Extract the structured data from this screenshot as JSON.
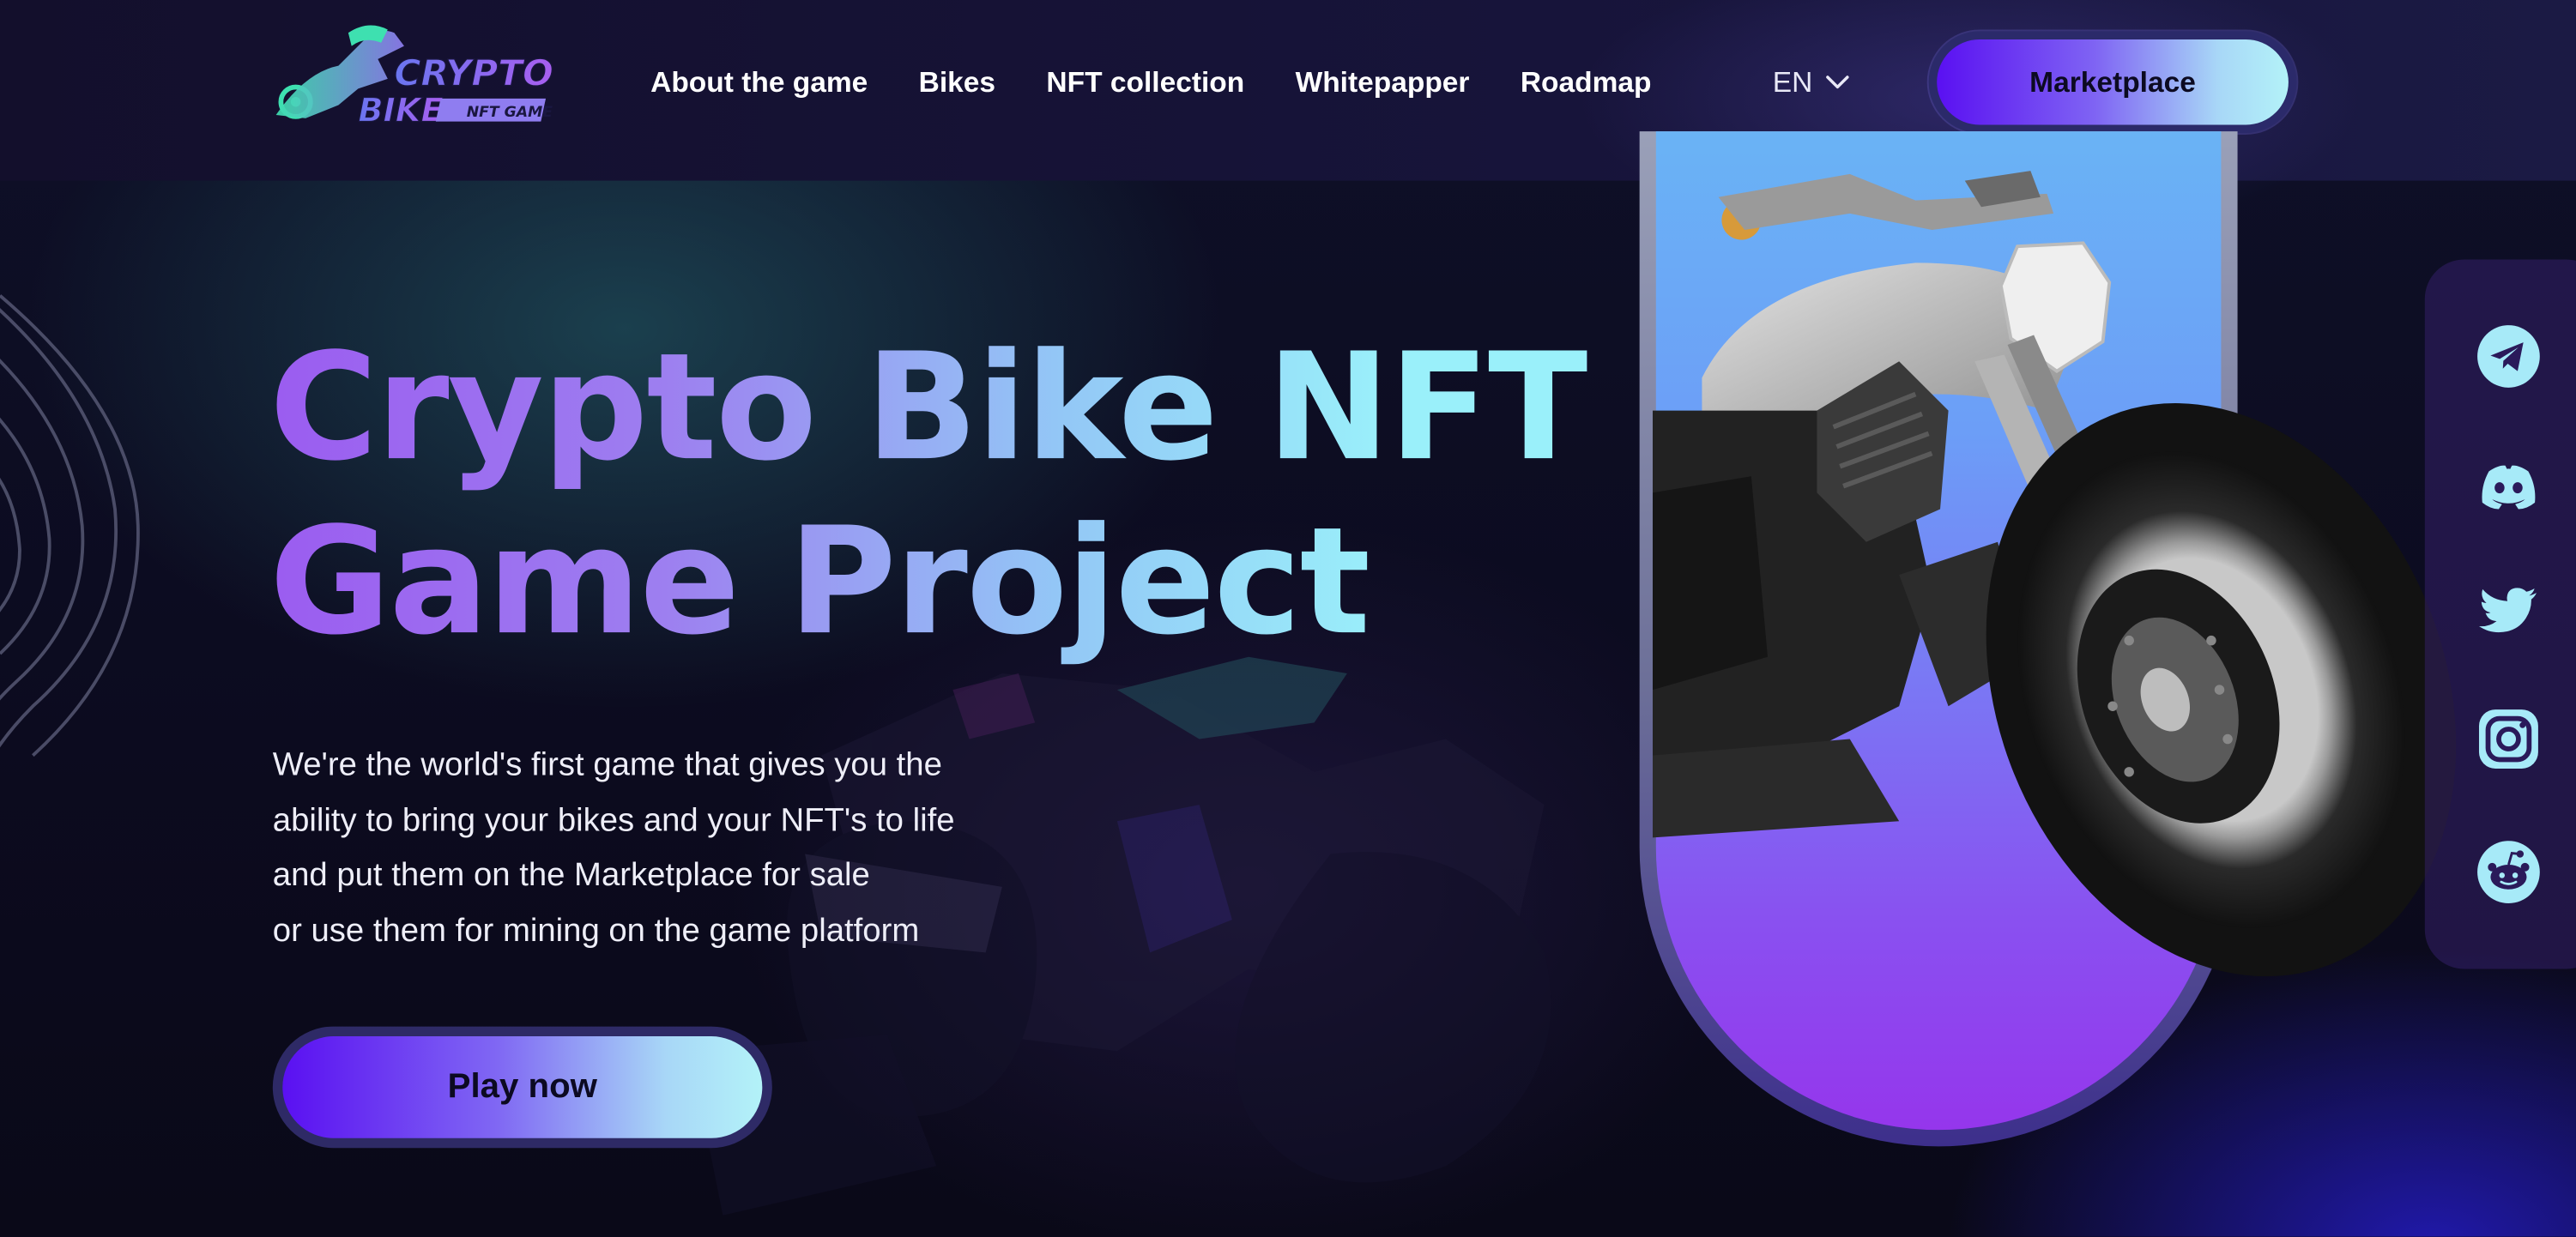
{
  "header": {
    "logo": {
      "word1": "CRYPTO",
      "word2": "BIKE",
      "tag": "NFT GAME"
    },
    "nav": [
      {
        "label": "About the game"
      },
      {
        "label": "Bikes"
      },
      {
        "label": "NFT collection"
      },
      {
        "label": "Whitepapper"
      },
      {
        "label": "Roadmap"
      }
    ],
    "language": "EN",
    "marketplace_label": "Marketplace"
  },
  "hero": {
    "title_line1": "Crypto Bike NFT",
    "title_line2": "Game Project",
    "description": [
      "We're the world's first game that gives you the",
      "ability to bring your bikes and your NFT's to life",
      "and put them on the Marketplace for sale",
      "or use them for mining on the game platform"
    ],
    "cta_label": "Play now"
  },
  "social": [
    {
      "icon": "telegram-icon"
    },
    {
      "icon": "discord-icon"
    },
    {
      "icon": "twitter-icon"
    },
    {
      "icon": "instagram-icon"
    },
    {
      "icon": "reddit-icon"
    }
  ],
  "colors": {
    "accent_start": "#5a10f2",
    "accent_end": "#b3f2f8",
    "title_gradient_start": "#9b5cf0",
    "title_gradient_end": "#9af0fa",
    "social_icon": "#a7eaf8",
    "background": "#0c0b1f"
  }
}
